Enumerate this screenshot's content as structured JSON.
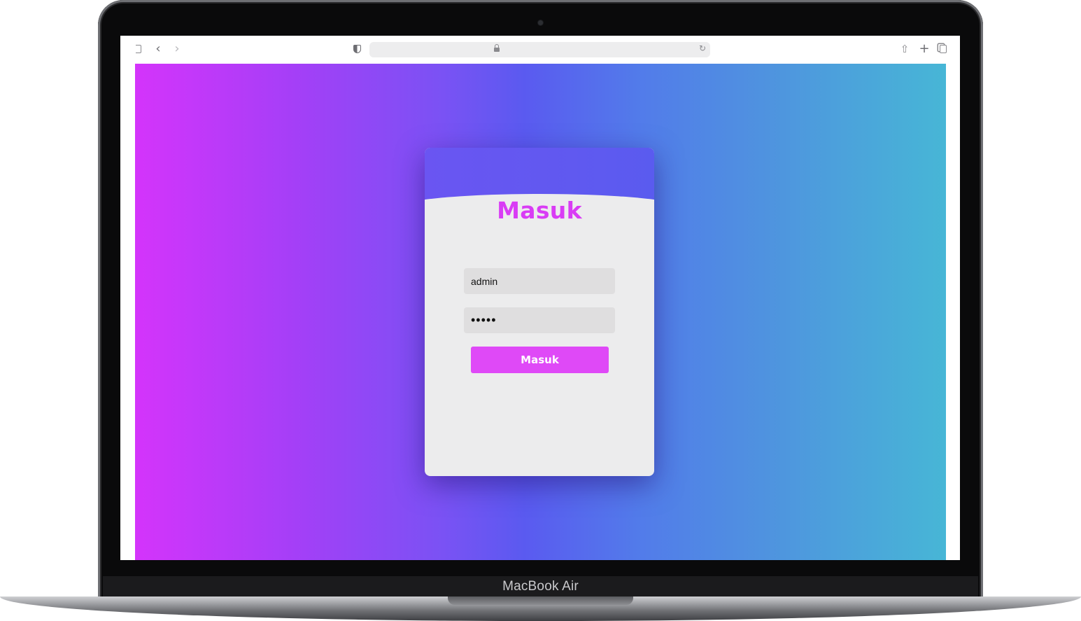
{
  "device": {
    "label": "MacBook Air"
  },
  "browser": {
    "address": {
      "url": ""
    }
  },
  "login": {
    "title": "Masuk",
    "username": {
      "value": "admin",
      "placeholder": ""
    },
    "password": {
      "value": "admin",
      "placeholder": ""
    },
    "submit_label": "Masuk"
  },
  "colors": {
    "gradient_start": "#d434fb",
    "gradient_mid": "#5a5af0",
    "gradient_end": "#47b6d6",
    "accent": "#df49f7",
    "title": "#d93cf5",
    "card": "#ececed"
  },
  "icons": [
    "sidebar-icon",
    "back-icon",
    "forward-icon",
    "shield-icon",
    "lock-icon",
    "reload-icon",
    "share-icon",
    "new-tab-icon",
    "tabs-overview-icon"
  ]
}
